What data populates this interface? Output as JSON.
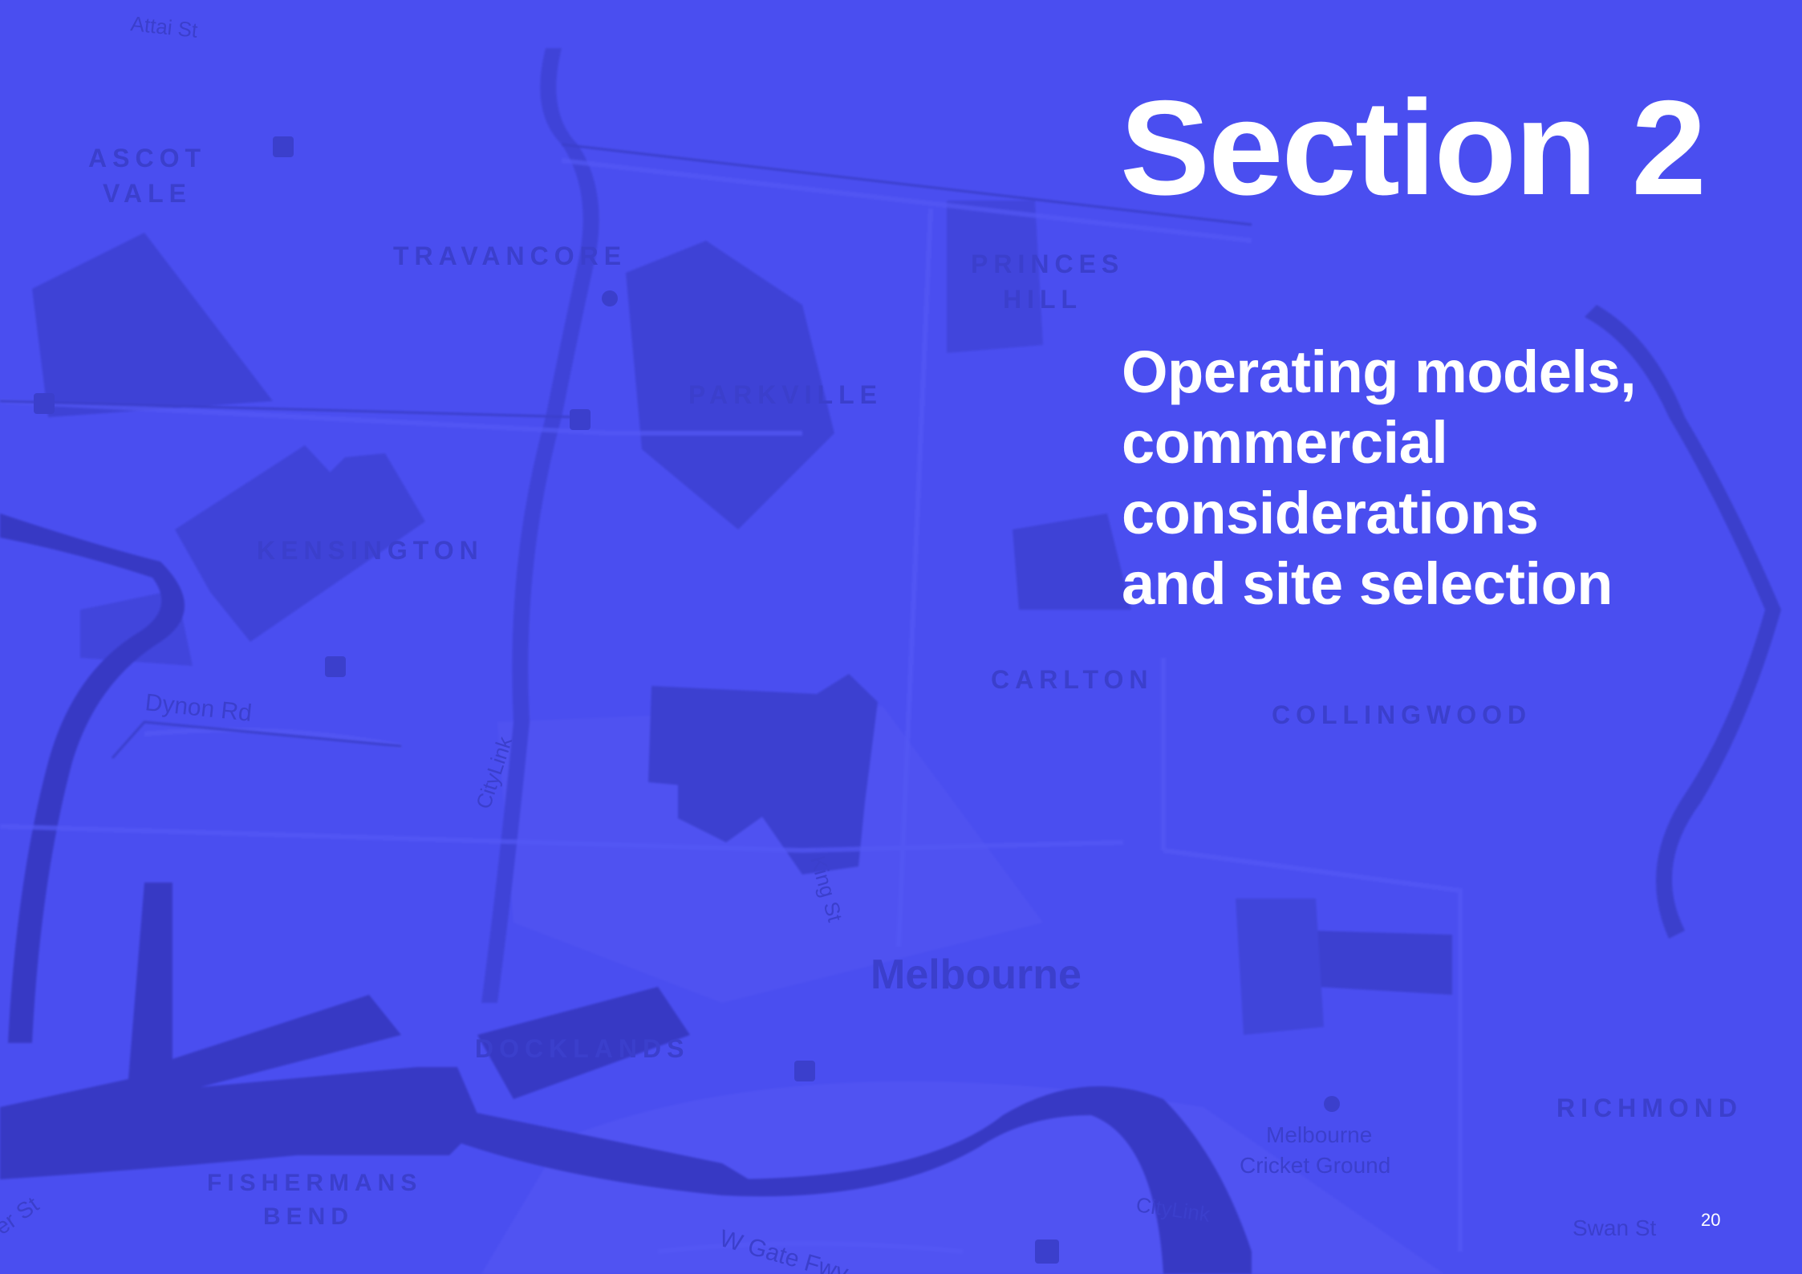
{
  "colors": {
    "background": "#4a4ef0",
    "map_dark": "#3b3fcc",
    "map_light": "#5356f3",
    "text": "#ffffff"
  },
  "map": {
    "labels": {
      "attai": "Attai St",
      "ascot_1": "ASCOT",
      "ascot_2": "VALE",
      "travancore": "TRAVANCORE",
      "princes_1": "PRINCES",
      "princes_2": "HILL",
      "parkville": "PARKVILLE",
      "kensington": "KENSINGTON",
      "carlton": "CARLTON",
      "collingwood": "COLLINGWOOD",
      "dynon": "Dynon Rd",
      "citylink": "CityLink",
      "king": "King St",
      "melbourne": "Melbourne",
      "docklands": "DOCKLANDS",
      "richmond": "RICHMOND",
      "mcg_1": "Melbourne",
      "mcg_2": "Cricket Ground",
      "citylink_2": "CityLink",
      "fishermans_1": "FISHERMANS",
      "fishermans_2": "BEND",
      "wgate": "W Gate Fwy",
      "swan": "Swan St",
      "lorimer": "er St"
    }
  },
  "slide": {
    "heading": "Section 2",
    "subheading_lines": [
      "Operating models,",
      "commercial",
      "considerations",
      "and site selection"
    ],
    "page_number": "20"
  }
}
